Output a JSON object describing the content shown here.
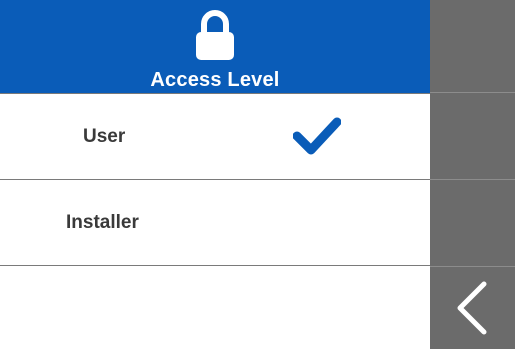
{
  "header": {
    "title": "Access Level",
    "icon": "lock-icon"
  },
  "options": [
    {
      "label": "User",
      "selected": true
    },
    {
      "label": "Installer",
      "selected": false
    }
  ],
  "sidebar": {
    "back_icon": "chevron-left-icon"
  },
  "colors": {
    "header_bg": "#0a5cb8",
    "checkmark": "#0a5cb8",
    "sidebar_bg": "#6b6b6b",
    "row_bg": "#ffffff",
    "text": "#3a3a3a"
  }
}
